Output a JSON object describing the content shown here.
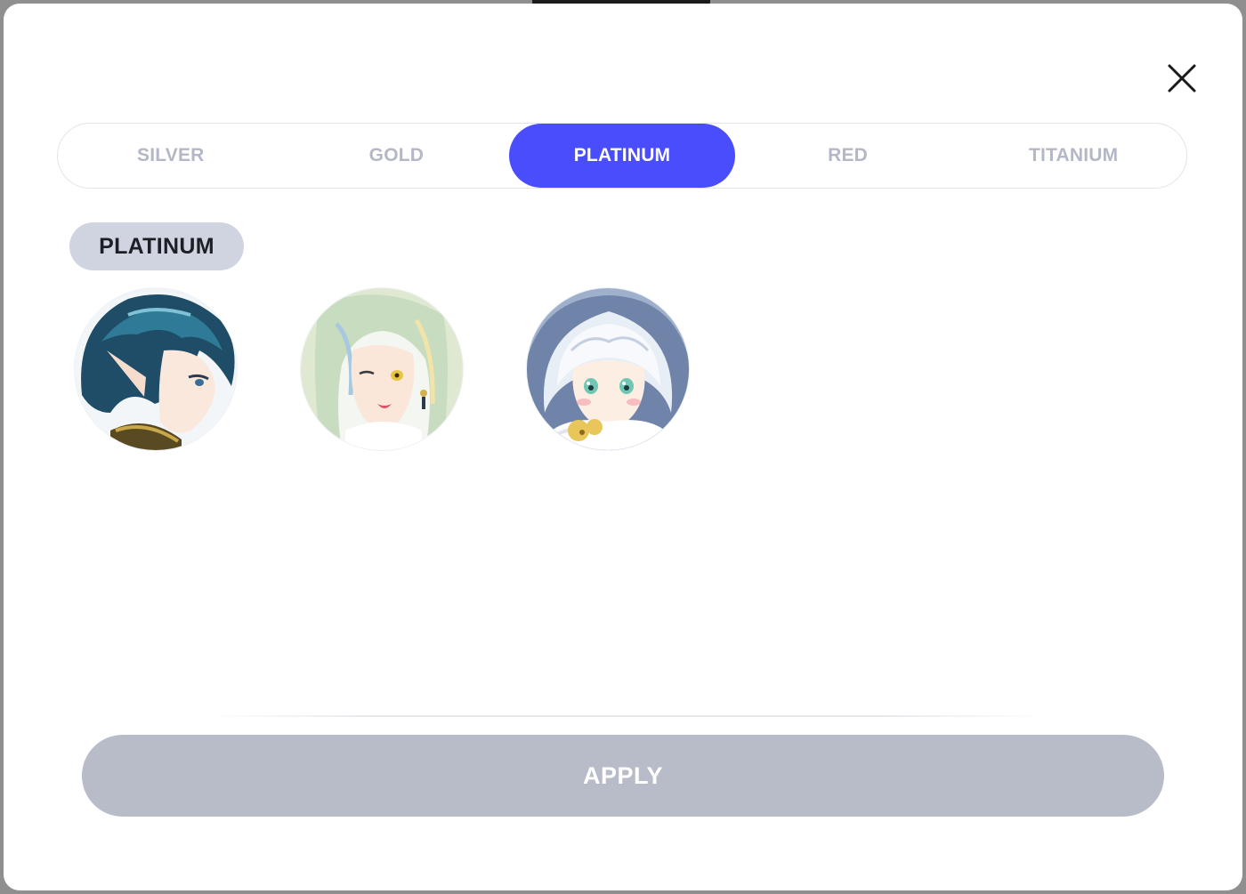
{
  "modal": {
    "close_icon": "close-icon"
  },
  "tabs": [
    {
      "label": "SILVER",
      "active": false
    },
    {
      "label": "GOLD",
      "active": false
    },
    {
      "label": "PLATINUM",
      "active": true
    },
    {
      "label": "RED",
      "active": false
    },
    {
      "label": "TITANIUM",
      "active": false
    }
  ],
  "tier_badge": {
    "label": "PLATINUM"
  },
  "avatars": [
    {
      "name": "avatar-blue-hair-elf"
    },
    {
      "name": "avatar-silver-hair-girl"
    },
    {
      "name": "avatar-white-hood-girl"
    }
  ],
  "footer": {
    "apply_label": "APPLY"
  },
  "colors": {
    "accent": "#4a4dfb",
    "tab_inactive_text": "#b4b8c6",
    "badge_bg": "#cfd4e0",
    "apply_disabled_bg": "#b8bcc9"
  }
}
